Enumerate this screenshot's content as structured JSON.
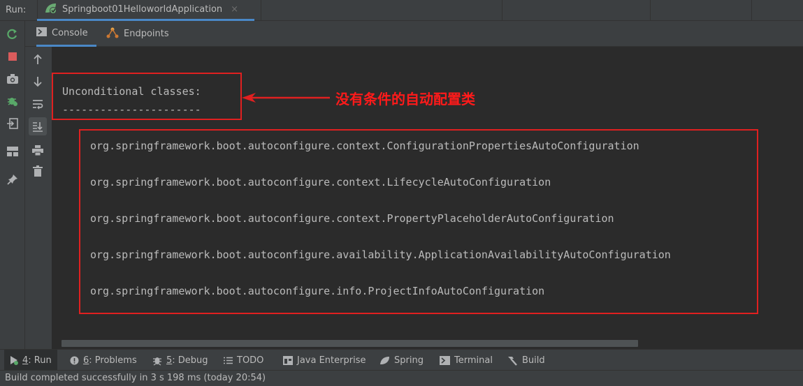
{
  "run_bar": {
    "label": "Run:",
    "tab_title": "Springboot01HelloworldApplication",
    "close": "×"
  },
  "subtabs": [
    {
      "label": "Console",
      "icon": "console-icon"
    },
    {
      "label": "Endpoints",
      "icon": "endpoints-icon"
    }
  ],
  "console": {
    "header": "Unconditional classes:",
    "dashes": "----------------------",
    "annotation": "没有条件的自动配置类",
    "classes": [
      "org.springframework.boot.autoconfigure.context.ConfigurationPropertiesAutoConfiguration",
      "org.springframework.boot.autoconfigure.context.LifecycleAutoConfiguration",
      "org.springframework.boot.autoconfigure.context.PropertyPlaceholderAutoConfiguration",
      "org.springframework.boot.autoconfigure.availability.ApplicationAvailabilityAutoConfiguration",
      "org.springframework.boot.autoconfigure.info.ProjectInfoAutoConfiguration"
    ]
  },
  "bottom_tools": {
    "run": {
      "num": "4",
      "rest": ": Run"
    },
    "problems": {
      "num": "6",
      "rest": ": Problems"
    },
    "debug": {
      "num": "5",
      "rest": ": Debug"
    },
    "todo": "TODO",
    "java_enterprise": "Java Enterprise",
    "spring": "Spring",
    "terminal": "Terminal",
    "build": "Build"
  },
  "status": "Build completed successfully in 3 s 198 ms (today 20:54)",
  "colors": {
    "accent": "#4a88c7",
    "annotation_red": "#e02020",
    "background": "#2b2b2b",
    "panel": "#3c3f41"
  }
}
